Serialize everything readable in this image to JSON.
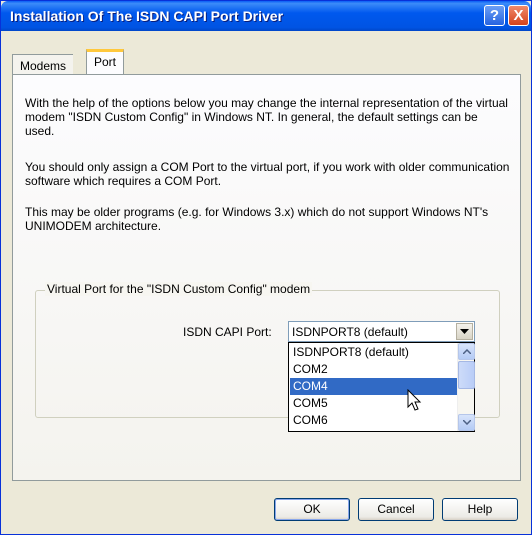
{
  "window": {
    "title": "Installation Of The ISDN CAPI Port Driver"
  },
  "titlebar_buttons": {
    "help": "?",
    "close": "X"
  },
  "tabs": [
    {
      "label": "Modems",
      "active": false
    },
    {
      "label": "Port",
      "active": true
    }
  ],
  "content": {
    "paragraph1": "With the help of the options below you may change the internal representation of the virtual modem \"ISDN Custom Config\" in Windows NT. In general, the default settings can be used.",
    "paragraph2": "You should only assign a COM Port to the virtual port, if you work with older communication software which requires a COM Port.",
    "paragraph3": "This may be older programs (e.g. for Windows 3.x) which do not support Windows NT's UNIMODEM architecture."
  },
  "group": {
    "legend": "Virtual Port for the \"ISDN Custom Config\" modem",
    "field_label": "ISDN CAPI Port:",
    "selected_value": "ISDNPORT8 (default)",
    "options": [
      {
        "label": "ISDNPORT8 (default)",
        "highlighted": false
      },
      {
        "label": "COM2",
        "highlighted": false
      },
      {
        "label": "COM4",
        "highlighted": true
      },
      {
        "label": "COM5",
        "highlighted": false
      },
      {
        "label": "COM6",
        "highlighted": false
      }
    ]
  },
  "buttons": {
    "ok": "OK",
    "cancel": "Cancel",
    "help": "Help"
  },
  "colors": {
    "title_bar": "#0054e3",
    "selection": "#316ac5",
    "dialog_bg": "#ece9d8"
  }
}
